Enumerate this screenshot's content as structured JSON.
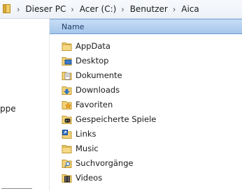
{
  "breadcrumb": {
    "items": [
      "Dieser PC",
      "Acer (C:)",
      "Benutzer",
      "Aica"
    ]
  },
  "navigation": {
    "partial_label": "ppe"
  },
  "list": {
    "column_header": "Name",
    "items": [
      {
        "label": "AppData",
        "icon": "folder-icon"
      },
      {
        "label": "Desktop",
        "icon": "desktop-folder-icon"
      },
      {
        "label": "Dokumente",
        "icon": "documents-folder-icon"
      },
      {
        "label": "Downloads",
        "icon": "downloads-folder-icon"
      },
      {
        "label": "Favoriten",
        "icon": "favorites-folder-icon"
      },
      {
        "label": "Gespeicherte Spiele",
        "icon": "saved-games-folder-icon"
      },
      {
        "label": "Links",
        "icon": "links-folder-icon"
      },
      {
        "label": "Music",
        "icon": "folder-icon"
      },
      {
        "label": "Suchvorgänge",
        "icon": "searches-folder-icon"
      },
      {
        "label": "Videos",
        "icon": "videos-folder-icon"
      }
    ]
  },
  "colors": {
    "header_bg": "#b9d4f1",
    "header_text": "#1f3c66",
    "folder": "#e8c15a"
  }
}
